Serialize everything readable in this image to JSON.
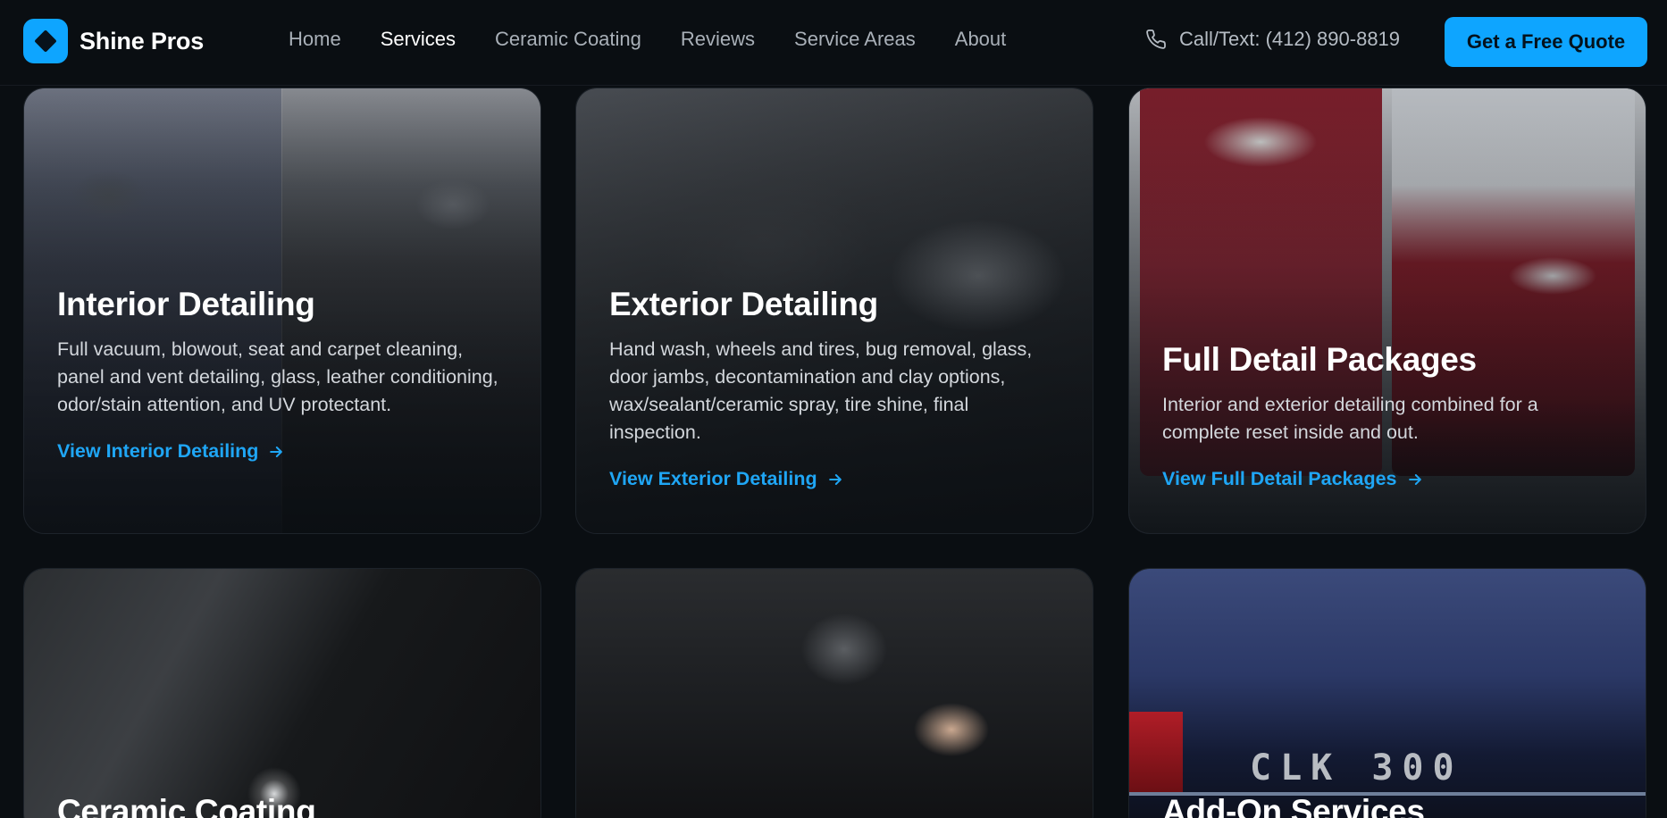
{
  "header": {
    "brand": "Shine Pros",
    "nav": [
      "Home",
      "Services",
      "Ceramic Coating",
      "Reviews",
      "Service Areas",
      "About"
    ],
    "active_nav": "Services",
    "phone": "Call/Text: (412) 890-8819",
    "cta": "Get a Free Quote"
  },
  "cards": [
    {
      "title": "Interior Detailing",
      "description": "Full vacuum, blowout, seat and carpet cleaning, panel and vent detailing, glass, leather conditioning, odor/stain attention, and UV protectant.",
      "link": "View Interior Detailing"
    },
    {
      "title": "Exterior Detailing",
      "description": "Hand wash, wheels and tires, bug removal, glass, door jambs, decontamination and clay options, wax/sealant/ceramic spray, tire shine, final inspection.",
      "link": "View Exterior Detailing"
    },
    {
      "title": "Full Detail Packages",
      "description": "Interior and exterior detailing combined for a complete reset inside and out.",
      "link": "View Full Detail Packages"
    },
    {
      "title": "Ceramic Coating"
    },
    {
      "title": ""
    },
    {
      "title": "Add-On Services",
      "image_text": "CLK 300"
    }
  ],
  "colors": {
    "background": "#0a0e12",
    "accent": "#0ea5ff",
    "link": "#1fa6f5"
  }
}
